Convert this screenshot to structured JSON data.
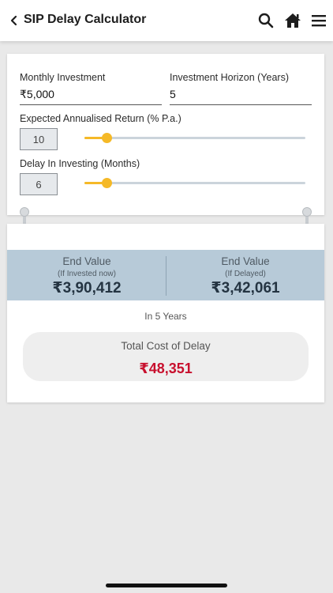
{
  "header": {
    "title": "SIP Delay Calculator"
  },
  "inputs": {
    "monthly_investment_label": "Monthly Investment",
    "monthly_investment_value": "₹5,000",
    "horizon_label": "Investment Horizon (Years)",
    "horizon_value": "5",
    "return_label": "Expected Annualised Return (% P.a.)",
    "return_value": "10",
    "delay_label": "Delay In Investing (Months)",
    "delay_value": "6"
  },
  "sliders": {
    "return_fraction": 0.1,
    "delay_fraction": 0.1
  },
  "results": {
    "end_value_now_title": "End Value",
    "end_value_now_sub": "(If Invested now)",
    "end_value_now": "₹3,90,412",
    "end_value_delayed_title": "End Value",
    "end_value_delayed_sub": "(If Delayed)",
    "end_value_delayed": "₹3,42,061",
    "period_text": "In 5 Years",
    "cost_title": "Total Cost of Delay",
    "cost_value": "₹48,351"
  },
  "colors": {
    "accent": "#f5b927",
    "result_band": "#b7cad8",
    "delay_cost": "#c8102e"
  },
  "icons": {
    "back": "chevron-left-icon",
    "search": "search-icon",
    "home": "home-icon",
    "menu": "hamburger-menu-icon"
  }
}
